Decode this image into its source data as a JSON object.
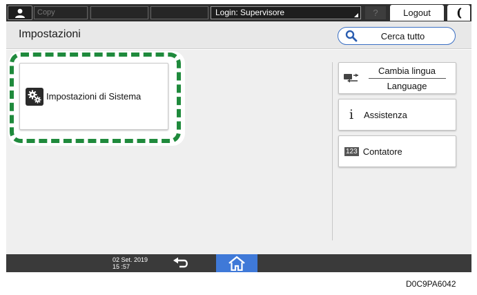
{
  "topbar": {
    "slot1_label": "Copy",
    "login_label": "Login: Supervisore",
    "help_label": "?",
    "logout_label": "Logout"
  },
  "header": {
    "title": "Impostazioni",
    "search_label": "Cerca tutto"
  },
  "main": {
    "system_settings_label": "Impostazioni di Sistema",
    "language_label_top": "Cambia lingua",
    "language_label_bottom": "Language",
    "help_label": "Assistenza",
    "counter_icon_text": "123",
    "counter_label": "Contatore"
  },
  "bottombar": {
    "date": "02 Set. 2019",
    "time": "15 :57"
  },
  "figure_code": "D0C9PA6042",
  "colors": {
    "highlight": "#1f8a3c",
    "home_accent": "#3f79d8",
    "search_border": "#3a6fc4"
  }
}
